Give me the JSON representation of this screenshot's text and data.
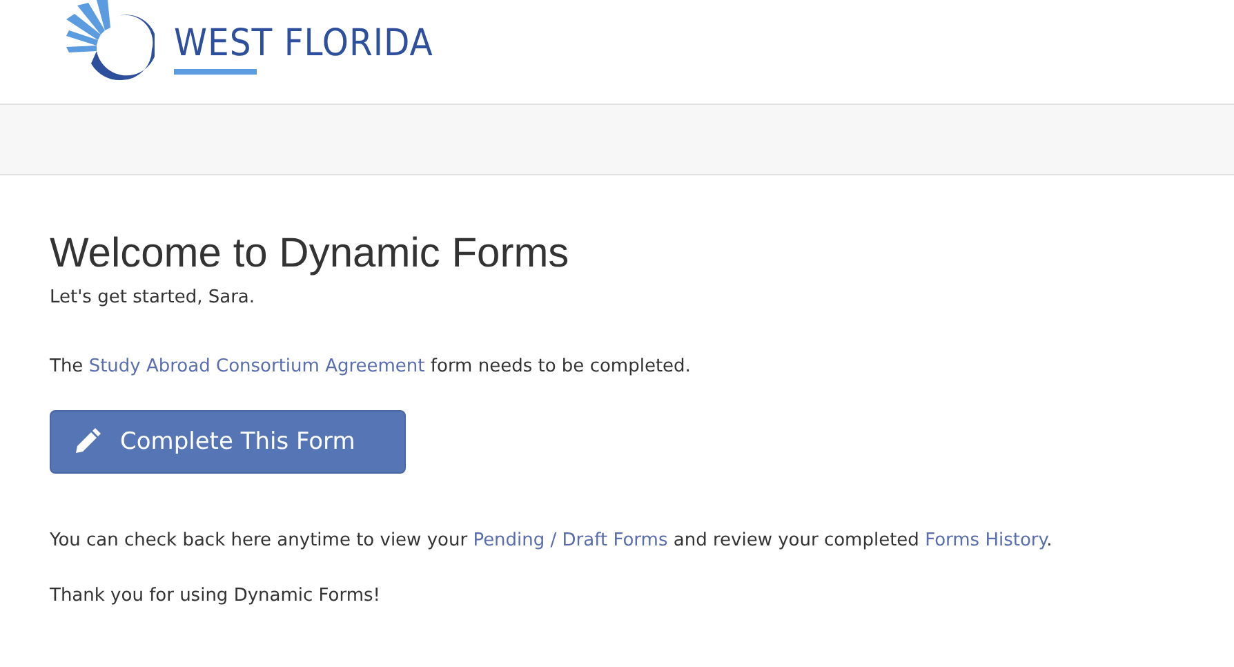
{
  "logo": {
    "name": "WEST FLORIDA"
  },
  "heading": "Welcome to Dynamic Forms",
  "greeting": "Let's get started, Sara.",
  "notice": {
    "before": "The ",
    "link": "Study Abroad Consortium Agreement",
    "after": " form needs to be completed."
  },
  "button": {
    "label": "Complete This Form"
  },
  "info": {
    "parts": [
      {
        "kind": "text",
        "text": "You can check back here anytime to view your "
      },
      {
        "kind": "link",
        "text": "Pending / Draft Forms"
      },
      {
        "kind": "text",
        "text": " and review your completed "
      },
      {
        "kind": "link",
        "text": "Forms History"
      },
      {
        "kind": "text",
        "text": "."
      }
    ]
  },
  "thanks": "Thank you for using Dynamic Forms!"
}
